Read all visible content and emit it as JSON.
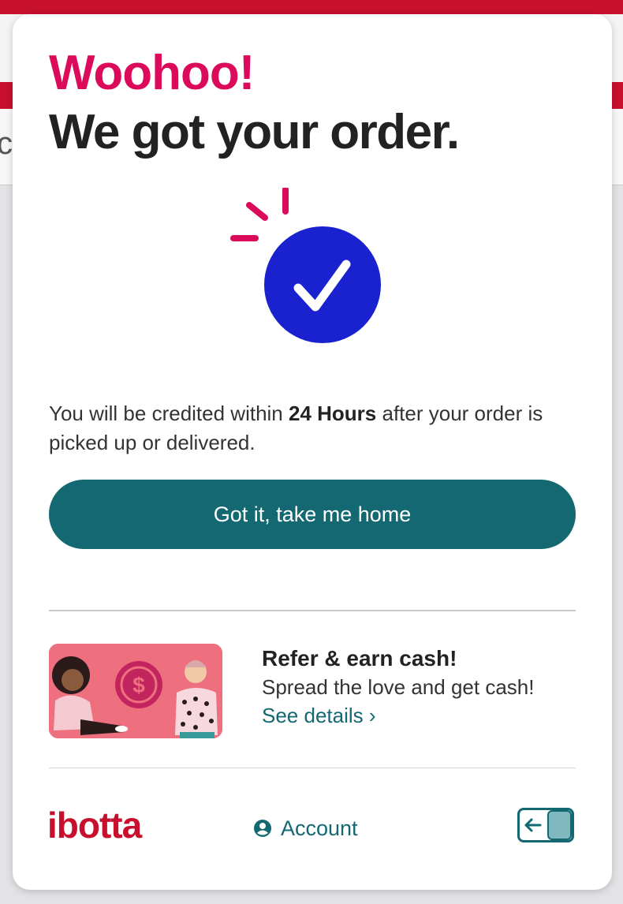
{
  "colors": {
    "accent_pink": "#dc0a5a",
    "brand_red": "#c8102e",
    "teal": "#136872",
    "check_blue": "#1a21cf"
  },
  "confirmation": {
    "exclaim": "Woohoo!",
    "headline": "We got your order.",
    "icon": "checkmark-circle-icon",
    "credit_prefix": "You will be credited within ",
    "credit_highlight": "24 Hours",
    "credit_suffix": " after your order is picked up or delivered.",
    "button_label": "Got it, take me home"
  },
  "referral": {
    "title": "Refer & earn cash!",
    "subtitle": "Spread the love and get cash!",
    "link": "See details ›"
  },
  "footer": {
    "logo": "ibotta",
    "account_label": "Account",
    "account_icon": "user-circle-icon",
    "collapse_icon": "arrow-left-icon"
  }
}
